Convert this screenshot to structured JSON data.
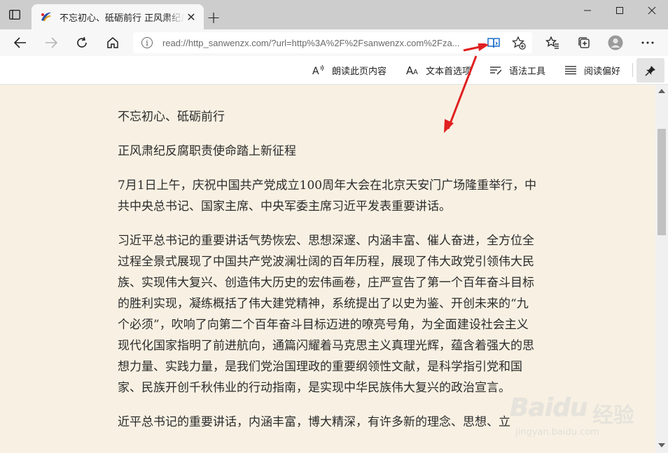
{
  "tab": {
    "title": "不忘初心、砥砺前行 正风肃纪反",
    "close_label": "✕",
    "new_tab_label": "+"
  },
  "address_bar": {
    "url": "read://http_sanwenzx.com/?url=http%3A%2F%2Fsanwenzx.com%2Fza..."
  },
  "reader_toolbar": {
    "read_aloud": "朗读此页内容",
    "text_prefs": "文本首选项",
    "grammar_tools": "语法工具",
    "reading_prefs": "阅读偏好"
  },
  "article": {
    "paragraphs": [
      "不忘初心、砥砺前行",
      "正风肃纪反腐职责使命踏上新征程",
      "7月1日上午，庆祝中国共产党成立100周年大会在北京天安门广场隆重举行，中共中央总书记、国家主席、中央军委主席习近平发表重要讲话。",
      "习近平总书记的重要讲话气势恢宏、思想深邃、内涵丰富、催人奋进，全方位全过程全景式展现了中国共产党波澜壮阔的百年历程，展现了伟大政党引领伟大民族、实现伟大复兴、创造伟大历史的宏伟画卷，庄严宣告了第一个百年奋斗目标的胜利实现，凝练概括了伟大建党精神，系统提出了以史为鉴、开创未来的“九个必须”，吹响了向第二个百年奋斗目标迈进的嘹亮号角，为全面建设社会主义现代化国家指明了前进航向，通篇闪耀着马克思主义真理光辉，蕴含着强大的思想力量、实践力量，是我们党治国理政的重要纲领性文献，是科学指引党和国家、民族开创千秋伟业的行动指南，是实现中华民族伟大复兴的政治宣言。",
      "近平总书记的重要讲话，内涵丰富，博大精深，有许多新的理念、思想、立"
    ]
  },
  "watermark": {
    "logo": "Baidu",
    "cn": "经验",
    "sub": "jingyan.baidu.com"
  },
  "colors": {
    "reader_bg": "#f8f1e3",
    "tab_strip": "#cdcdcd",
    "annotation_arrow": "#e02020",
    "reader_icon": "#1a6fc9"
  }
}
